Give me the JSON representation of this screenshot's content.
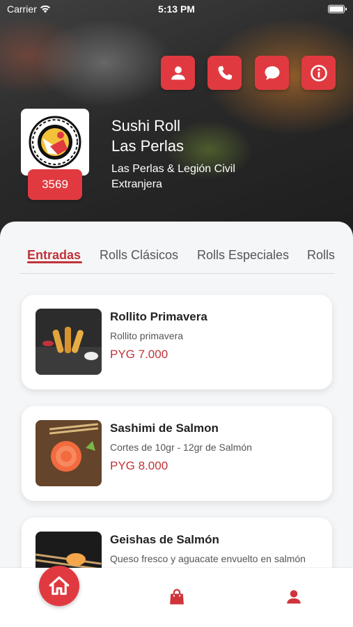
{
  "status_bar": {
    "carrier": "Carrier",
    "time": "5:13 PM"
  },
  "header": {
    "action_icons": [
      "user-icon",
      "phone-icon",
      "chat-icon",
      "info-icon"
    ],
    "store_name_line1": "Sushi Roll",
    "store_name_line2": "Las Perlas",
    "address_line1": "Las Perlas & Legión Civil",
    "address_line2": "Extranjera",
    "badge_count": "3569"
  },
  "tabs": [
    {
      "label": "Entradas",
      "active": true
    },
    {
      "label": "Rolls Clásicos",
      "active": false
    },
    {
      "label": "Rolls Especiales",
      "active": false
    },
    {
      "label": "Rolls",
      "active": false
    }
  ],
  "products": [
    {
      "name": "Rollito Primavera",
      "description": "Rollito primavera",
      "price": "PYG 7.000"
    },
    {
      "name": "Sashimi de Salmon",
      "description": "Cortes de 10gr - 12gr de Salmón",
      "price": "PYG 8.000"
    },
    {
      "name": "Geishas de Salmón",
      "description": "Queso fresco y aguacate envuelto en salmón fresco",
      "price": ""
    }
  ],
  "bottom_nav": {
    "items": [
      "home-icon",
      "shopping-bag-icon",
      "profile-icon"
    ]
  },
  "colors": {
    "accent": "#e03a40",
    "accent_text": "#c0333a"
  }
}
